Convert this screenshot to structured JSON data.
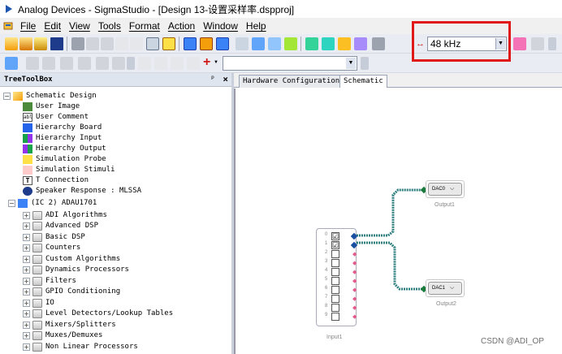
{
  "window": {
    "title": "Analog Devices - SigmaStudio - [Design 13-设置采样率.dspproj]"
  },
  "menu": {
    "items": [
      "File",
      "Edit",
      "View",
      "Tools",
      "Format",
      "Action",
      "Window",
      "Help"
    ]
  },
  "toolbar": {
    "sample_rate": "48 kHz"
  },
  "toolbox": {
    "title": "TreeToolBox",
    "pin_glyph": "ᵖ",
    "close_glyph": "×",
    "nodes": [
      "Schematic Design",
      "User Image",
      "User Comment",
      "Hierarchy Board",
      "Hierarchy Input",
      "Hierarchy Output",
      "Simulation Probe",
      "Simulation Stimuli",
      "T Connection",
      "Speaker Response : MLSSA",
      "(IC 2) ADAU1701",
      "ADI Algorithms",
      "Advanced DSP",
      "Basic DSP",
      "Counters",
      "Custom Algorithms",
      "Dynamics Processors",
      "Filters",
      "GPIO Conditioning",
      "IO",
      "Level Detectors/Lookup Tables",
      "Mixers/Splitters",
      "Muxes/Demuxes",
      "Non Linear Processors"
    ]
  },
  "tabs": [
    "Hardware Configuration",
    "Schematic"
  ],
  "schematic": {
    "input_block": {
      "label": "Input1",
      "rows": [
        "0",
        "1",
        "2",
        "3",
        "4",
        "5",
        "6",
        "7",
        "8",
        "9"
      ],
      "checked": [
        true,
        true,
        false,
        false,
        false,
        false,
        false,
        false,
        false,
        false
      ]
    },
    "dac0": {
      "select": "DAC0",
      "label": "Output1"
    },
    "dac1": {
      "select": "DAC1",
      "label": "Output2"
    }
  },
  "watermark": "CSDN @ADI_OP",
  "colors": {
    "highlight": "#e01818",
    "wire": "#2f7f7f",
    "pin": "#1a4ea0"
  }
}
